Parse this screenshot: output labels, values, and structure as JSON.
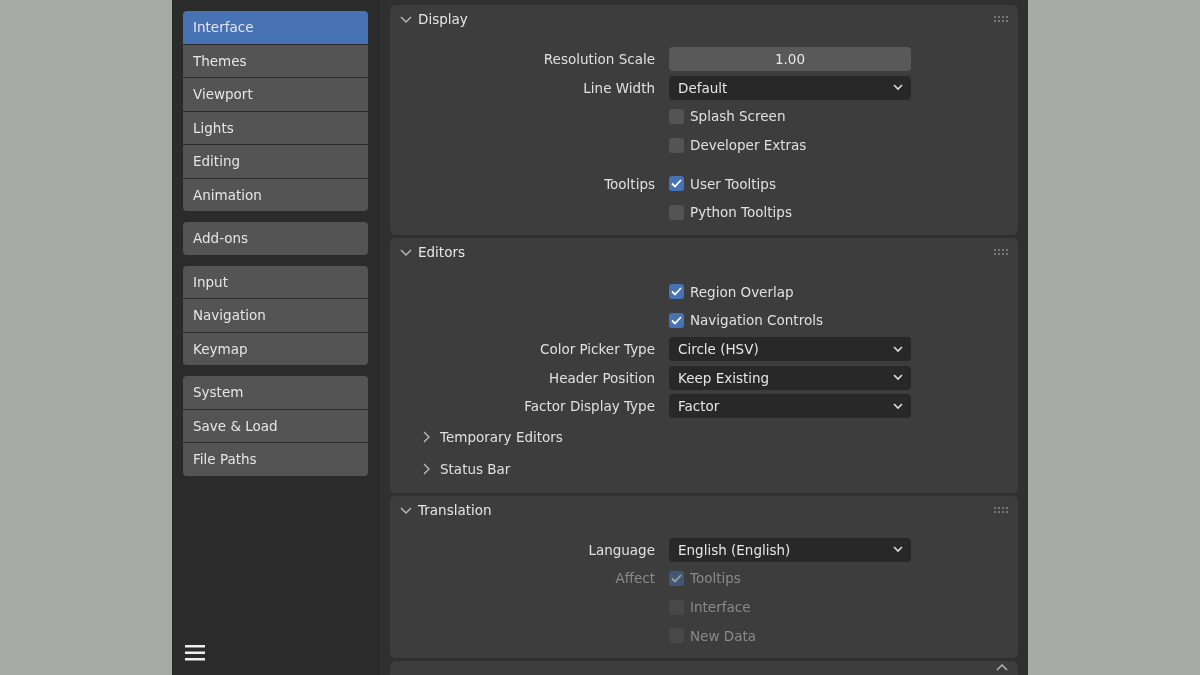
{
  "sidebar": {
    "groups": [
      {
        "items": [
          {
            "label": "Interface",
            "selected": true
          },
          {
            "label": "Themes",
            "selected": false
          },
          {
            "label": "Viewport",
            "selected": false
          },
          {
            "label": "Lights",
            "selected": false
          },
          {
            "label": "Editing",
            "selected": false
          },
          {
            "label": "Animation",
            "selected": false
          }
        ]
      },
      {
        "items": [
          {
            "label": "Add-ons",
            "selected": false
          }
        ]
      },
      {
        "items": [
          {
            "label": "Input",
            "selected": false
          },
          {
            "label": "Navigation",
            "selected": false
          },
          {
            "label": "Keymap",
            "selected": false
          }
        ]
      },
      {
        "items": [
          {
            "label": "System",
            "selected": false
          },
          {
            "label": "Save & Load",
            "selected": false
          },
          {
            "label": "File Paths",
            "selected": false
          }
        ]
      }
    ]
  },
  "sections": [
    {
      "title": "Display",
      "expanded": true,
      "items": [
        {
          "kind": "number",
          "label": "Resolution Scale",
          "value": "1.00",
          "disabled": false
        },
        {
          "kind": "dropdown",
          "label": "Line Width",
          "value": "Default",
          "disabled": false
        },
        {
          "kind": "checkbox",
          "text": "Splash Screen",
          "checked": false,
          "disabled": false
        },
        {
          "kind": "checkbox",
          "text": "Developer Extras",
          "checked": false,
          "disabled": false
        },
        {
          "kind": "checkbox",
          "label": "Tooltips",
          "text": "User Tooltips",
          "checked": true,
          "disabled": false
        },
        {
          "kind": "checkbox",
          "text": "Python Tooltips",
          "checked": false,
          "disabled": false
        }
      ]
    },
    {
      "title": "Editors",
      "expanded": true,
      "items": [
        {
          "kind": "checkbox",
          "text": "Region Overlap",
          "checked": true,
          "disabled": false
        },
        {
          "kind": "checkbox",
          "text": "Navigation Controls",
          "checked": true,
          "disabled": false
        },
        {
          "kind": "dropdown",
          "label": "Color Picker Type",
          "value": "Circle (HSV)",
          "disabled": false
        },
        {
          "kind": "dropdown",
          "label": "Header Position",
          "value": "Keep Existing",
          "disabled": false
        },
        {
          "kind": "dropdown",
          "label": "Factor Display Type",
          "value": "Factor",
          "disabled": false
        },
        {
          "kind": "subpanel",
          "text": "Temporary Editors",
          "expanded": false
        },
        {
          "kind": "subpanel",
          "text": "Status Bar",
          "expanded": false
        }
      ]
    },
    {
      "title": "Translation",
      "expanded": true,
      "items": [
        {
          "kind": "dropdown",
          "label": "Language",
          "value": "English (English)",
          "disabled": false
        },
        {
          "kind": "checkbox",
          "label": "Affect",
          "text": "Tooltips",
          "checked": true,
          "disabled": true
        },
        {
          "kind": "checkbox",
          "text": "Interface",
          "checked": false,
          "disabled": true
        },
        {
          "kind": "checkbox",
          "text": "New Data",
          "checked": false,
          "disabled": true
        }
      ]
    }
  ]
}
